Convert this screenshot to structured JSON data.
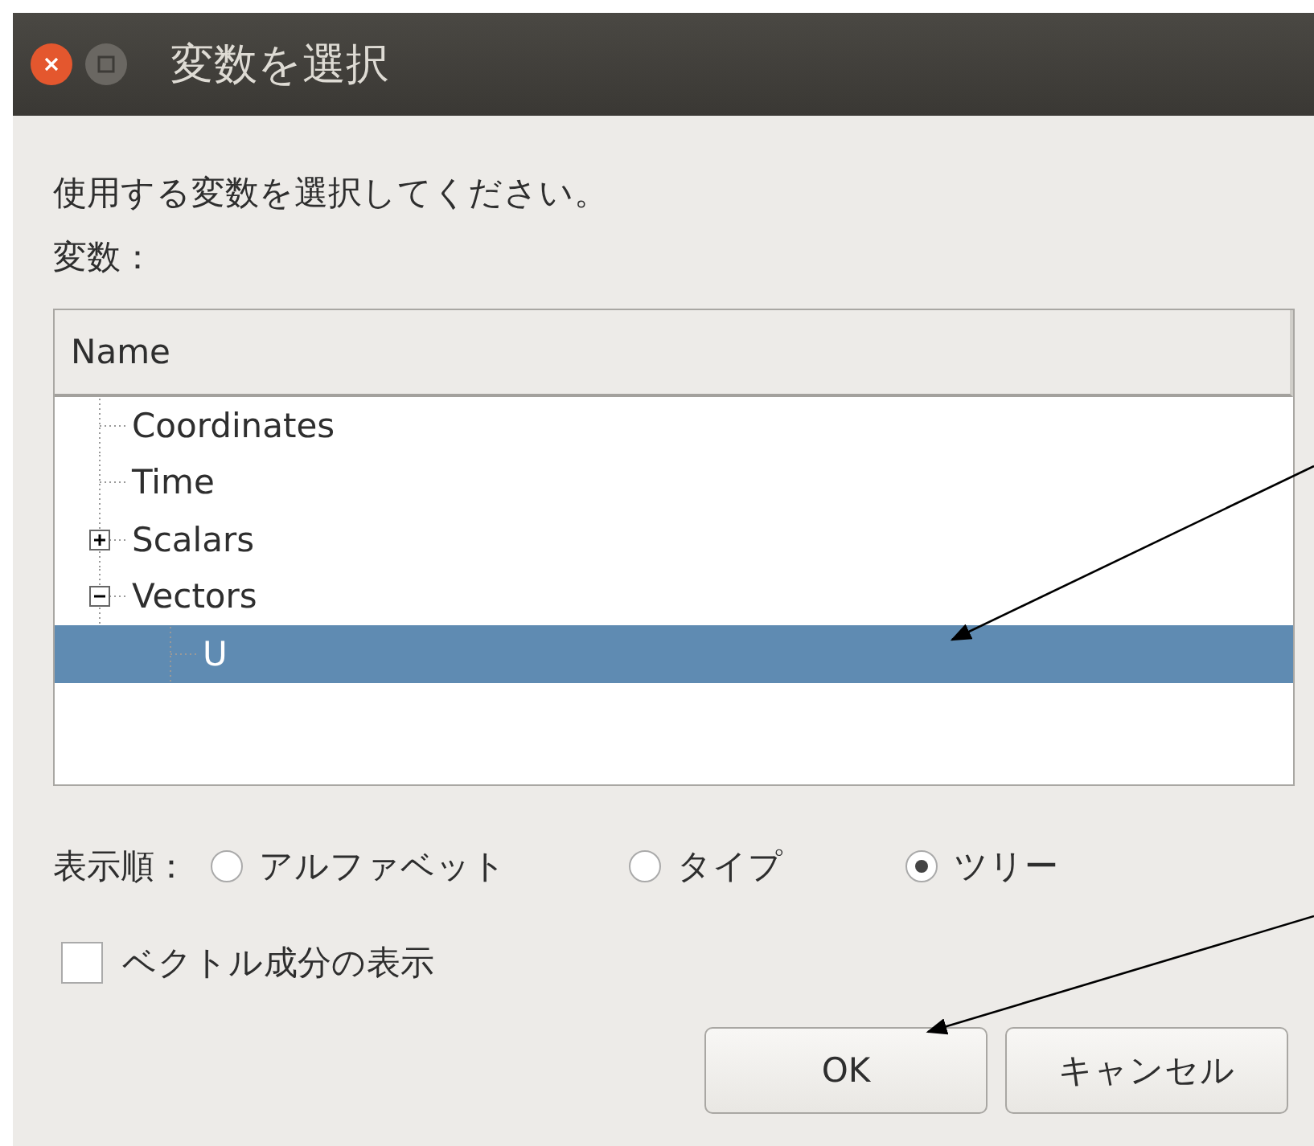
{
  "window": {
    "title": "変数を選択"
  },
  "prompt": "使用する変数を選択してください。",
  "variables_label": "変数：",
  "tree": {
    "columns": [
      "Name"
    ],
    "items": [
      {
        "label": "Coordinates",
        "selected": false
      },
      {
        "label": "Time",
        "selected": false
      },
      {
        "label": "Scalars",
        "selected": false,
        "expanded": false
      },
      {
        "label": "Vectors",
        "selected": false,
        "expanded": true,
        "children": [
          {
            "label": "U",
            "selected": true
          }
        ]
      }
    ]
  },
  "sort_order": {
    "label": "表示順：",
    "options": [
      {
        "label": "アルファベット",
        "selected": false
      },
      {
        "label": "タイプ",
        "selected": false
      },
      {
        "label": "ツリー",
        "selected": true
      }
    ]
  },
  "vector_components": {
    "label": "ベクトル成分の表示",
    "checked": false
  },
  "buttons": [
    {
      "label": "OK"
    },
    {
      "label": "キャンセル"
    }
  ]
}
